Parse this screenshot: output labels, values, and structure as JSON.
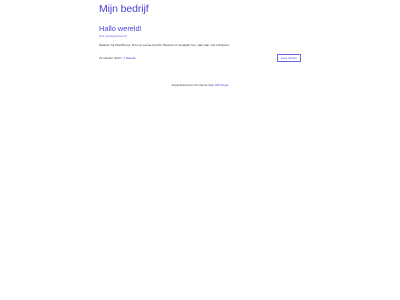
{
  "header": {
    "site_title": "Mijn bedrijf"
  },
  "post": {
    "title": "Hallo wereld!",
    "subtitle": "Niet gecategoriseerd",
    "content": "Welkom bij WordPress. Dit is je eerste bericht. Bewerk of verwijder het, start dan met schrijven!",
    "date": "23 oktober 2023",
    "separator": "/",
    "comments": "1 Reactie",
    "read_more": "Lees Verder"
  },
  "footer": {
    "text": "Royal Elementor Kit thema door",
    "link": "WP Royal"
  },
  "colors": {
    "accent": "#4a42d8",
    "text": "#333333",
    "background": "#ffffff"
  }
}
